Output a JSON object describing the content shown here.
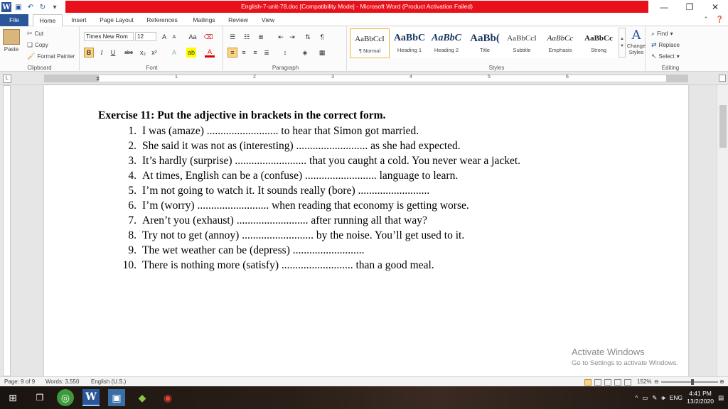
{
  "window": {
    "title": "English-7-unit-78.doc [Compatibility Mode]  -  Microsoft Word (Product Activation Failed)"
  },
  "tabs": [
    "File",
    "Home",
    "Insert",
    "Page Layout",
    "References",
    "Mailings",
    "Review",
    "View"
  ],
  "clipboard": {
    "paste": "Paste",
    "cut": "Cut",
    "copy": "Copy",
    "format_painter": "Format Painter",
    "label": "Clipboard"
  },
  "font": {
    "name": "Times New Rom",
    "size": "12",
    "label": "Font",
    "bold": "B",
    "italic": "I",
    "underline": "U",
    "strike": "abe",
    "sub": "x₂",
    "sup": "x²"
  },
  "paragraph": {
    "label": "Paragraph"
  },
  "styles": {
    "label": "Styles",
    "items": [
      {
        "preview": "AaBbCcI",
        "name": "¶ Normal"
      },
      {
        "preview": "AaBbC",
        "name": "Heading 1"
      },
      {
        "preview": "AaBbC",
        "name": "Heading 2"
      },
      {
        "preview": "AaBb(",
        "name": "Title"
      },
      {
        "preview": "AaBbCcI",
        "name": "Subtitle"
      },
      {
        "preview": "AaBbCc",
        "name": "Emphasis"
      },
      {
        "preview": "AaBbCc",
        "name": "Strong"
      }
    ],
    "change": "Change Styles"
  },
  "editing": {
    "label": "Editing",
    "find": "Find",
    "replace": "Replace",
    "select": "Select"
  },
  "ruler_numbers": [
    "1",
    "2",
    "3",
    "4",
    "5",
    "6"
  ],
  "document": {
    "title": "Exercise 11: Put the adjective in brackets in the correct form.",
    "items": [
      {
        "n": "1.",
        "text": "I was (amaze) .......................... to hear that Simon got married."
      },
      {
        "n": "2.",
        "text": "She said it was not as (interesting) .......................... as she had expected."
      },
      {
        "n": "3.",
        "text": "It’s hardly (surprise) .......................... that you caught a cold. You never wear a jacket."
      },
      {
        "n": "4.",
        "text": "At times, English can be a (confuse) .......................... language to learn."
      },
      {
        "n": "5.",
        "text": "I’m not going to watch it. It sounds really (bore) .........................."
      },
      {
        "n": "6.",
        "text": "I’m (worry) .......................... when reading that economy is getting worse."
      },
      {
        "n": "7.",
        "text": "Aren’t you (exhaust) .......................... after running all that way?"
      },
      {
        "n": "8.",
        "text": "Try not to get (annoy) .......................... by the noise. You’ll get used to it."
      },
      {
        "n": "9.",
        "text": "The wet weather can be (depress) .........................."
      },
      {
        "n": "10.",
        "text": "There is nothing more (satisfy) .......................... than a good meal."
      }
    ]
  },
  "watermark": {
    "line1": "Activate Windows",
    "line2": "Go to Settings to activate Windows."
  },
  "status": {
    "page": "Page: 9 of 9",
    "words": "Words: 3,550",
    "lang": "English (U.S.)",
    "zoom": "152%"
  },
  "taskbar": {
    "lang": "ENG",
    "time": "4:41 PM",
    "date": "13/2/2020"
  },
  "colors": {
    "word_blue": "#2b579a",
    "title_red": "#e8101a"
  }
}
